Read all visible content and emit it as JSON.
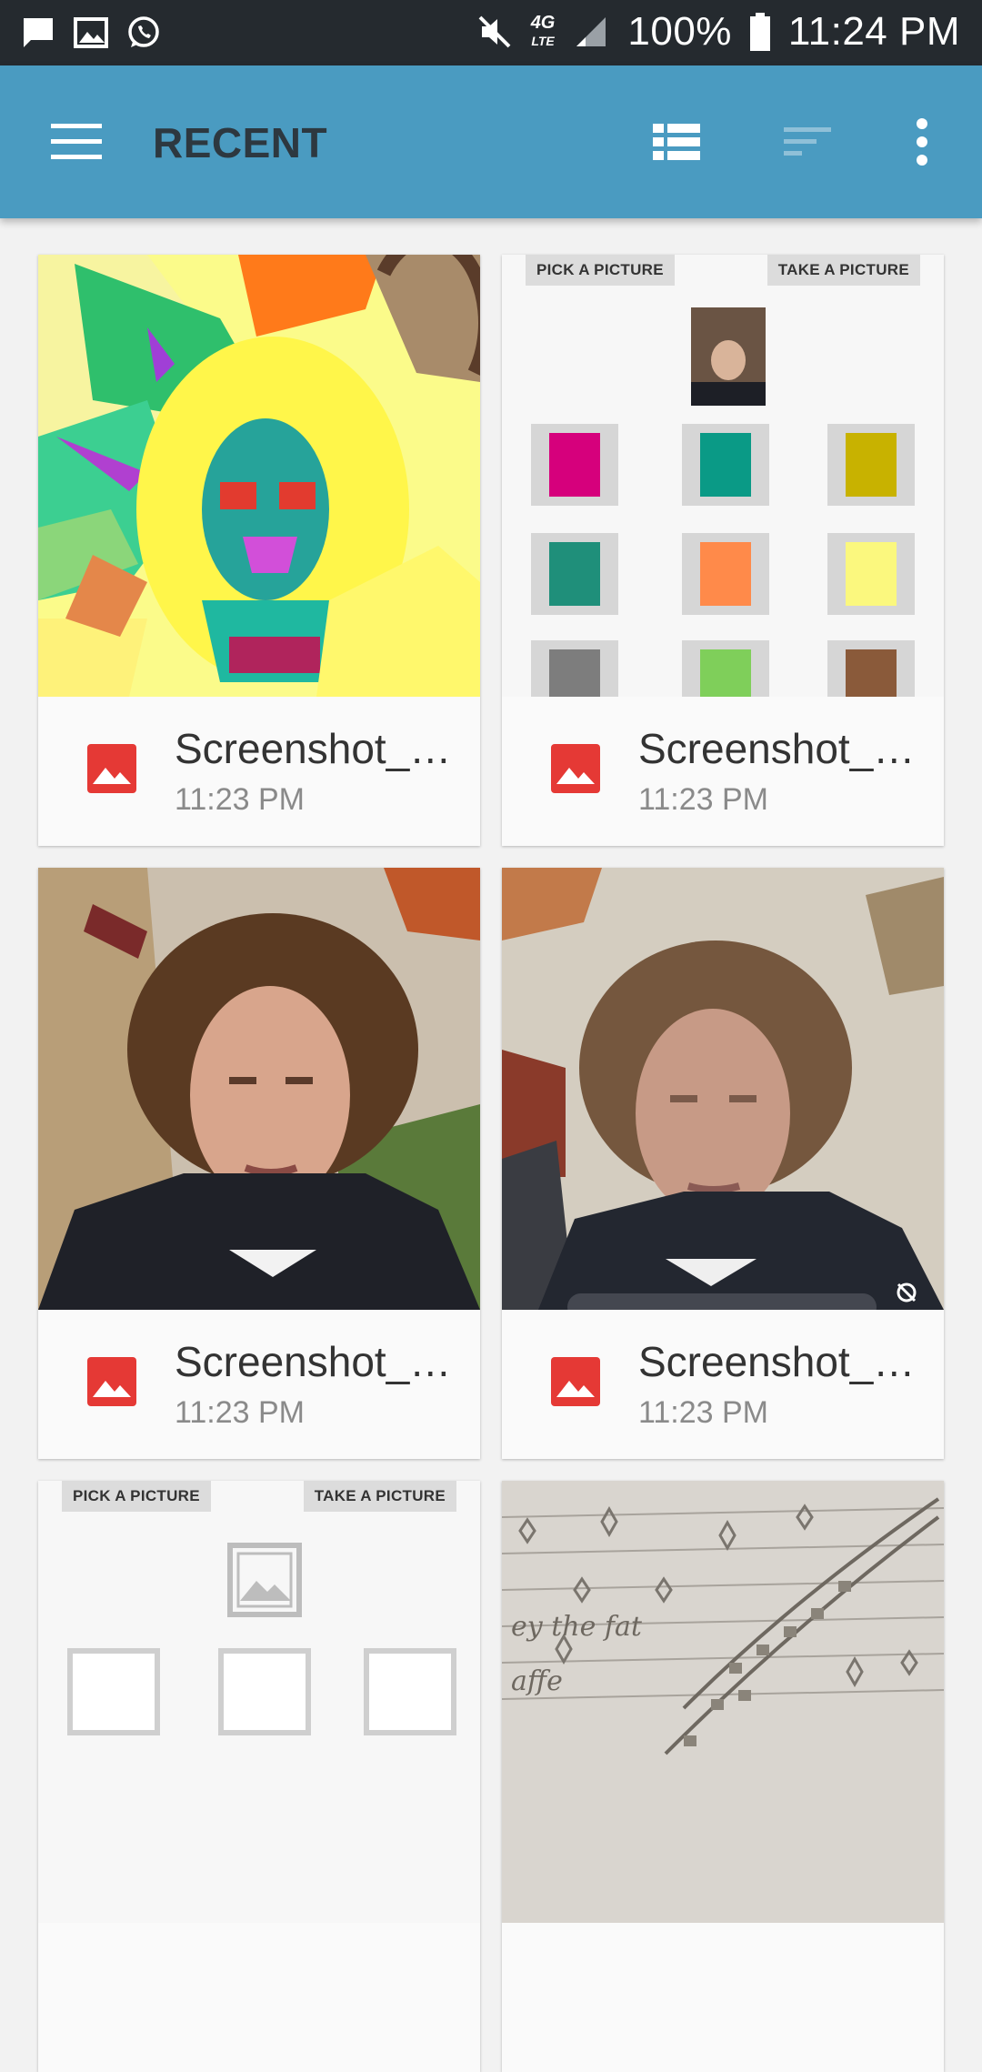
{
  "status_bar": {
    "battery": "100%",
    "time": "11:24 PM",
    "network": "4G",
    "network_sub": "LTE"
  },
  "app_bar": {
    "title": "RECENT"
  },
  "app_screens": {
    "pick_label": "PICK A PICTURE",
    "take_label": "TAKE A PICTURE"
  },
  "files": [
    {
      "name": "Screenshot_…",
      "time": "11:23 PM"
    },
    {
      "name": "Screenshot_…",
      "time": "11:23 PM"
    },
    {
      "name": "Screenshot_…",
      "time": "11:23 PM"
    },
    {
      "name": "Screenshot_…",
      "time": "11:23 PM"
    }
  ],
  "colors": {
    "app_bar": "#4a9bc1",
    "status_bar": "#252a2f",
    "image_icon": "#e53935"
  }
}
